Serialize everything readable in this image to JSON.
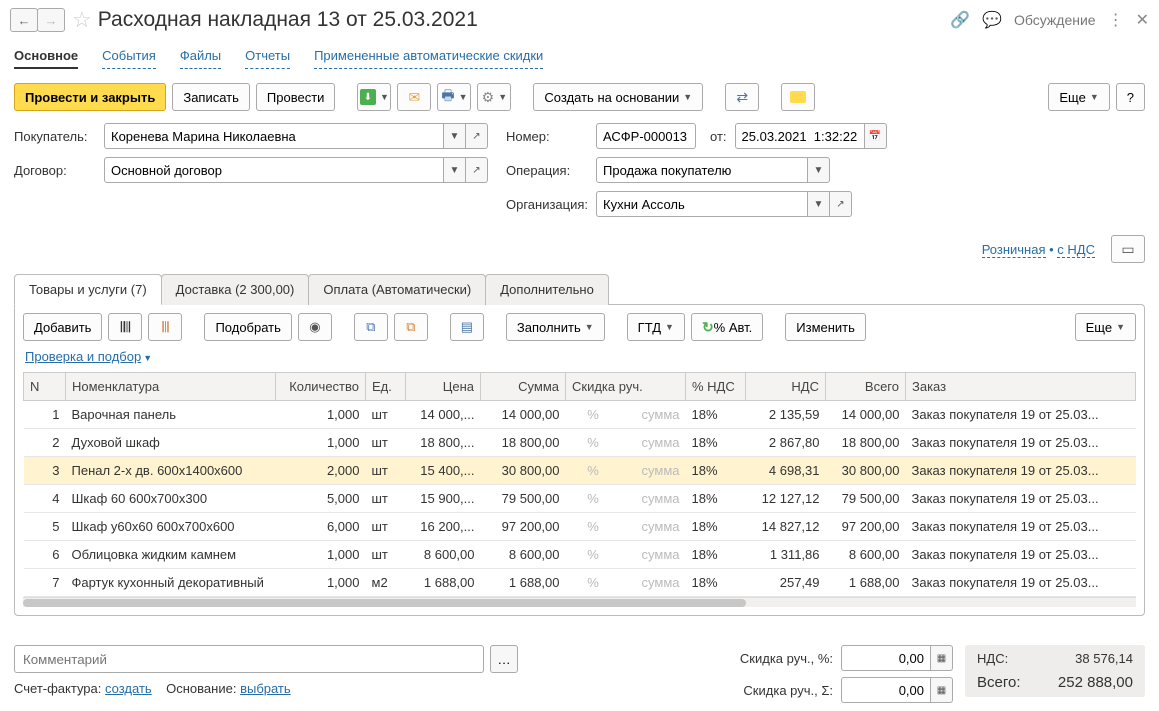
{
  "header": {
    "title": "Расходная накладная 13  от 25.03.2021",
    "discuss": "Обсуждение"
  },
  "nav": {
    "main": "Основное",
    "events": "События",
    "files": "Файлы",
    "reports": "Отчеты",
    "auto_discounts": "Примененные автоматические скидки"
  },
  "toolbar": {
    "post_close": "Провести и закрыть",
    "save": "Записать",
    "post": "Провести",
    "create_based": "Создать на основании",
    "more": "Еще",
    "help": "?"
  },
  "form": {
    "buyer_label": "Покупатель:",
    "buyer": "Коренева Марина Николаевна",
    "number_label": "Номер:",
    "number": "АСФР-000013",
    "date_label": "от:",
    "date": "25.03.2021  1:32:22",
    "contract_label": "Договор:",
    "contract": "Основной договор",
    "operation_label": "Операция:",
    "operation": "Продажа покупателю",
    "org_label": "Организация:",
    "org": "Кухни Ассоль",
    "retail": "Розничная",
    "vat": "с НДС"
  },
  "tabs": {
    "goods": "Товары и услуги (7)",
    "delivery": "Доставка (2 300,00)",
    "payment": "Оплата (Автоматически)",
    "extra": "Дополнительно"
  },
  "table_toolbar": {
    "add": "Добавить",
    "select": "Подобрать",
    "fill": "Заполнить",
    "gtd": "ГТД",
    "auto_pct": "% Авт.",
    "change": "Изменить",
    "more": "Еще",
    "check_select": "Проверка и подбор"
  },
  "columns": {
    "n": "N",
    "item": "Номенклатура",
    "qty": "Количество",
    "unit": "Ед.",
    "price": "Цена",
    "sum": "Сумма",
    "man_disc": "Скидка руч.",
    "vat_pct": "% НДС",
    "vat": "НДС",
    "total": "Всего",
    "order": "Заказ"
  },
  "placeholders": {
    "pct": "%",
    "sum": "сумма"
  },
  "rows": [
    {
      "n": "1",
      "item": "Варочная панель",
      "qty": "1,000",
      "unit": "шт",
      "price": "14 000,...",
      "sum": "14 000,00",
      "vat_pct": "18%",
      "vat": "2 135,59",
      "total": "14 000,00",
      "order": "Заказ покупателя 19 от 25.03..."
    },
    {
      "n": "2",
      "item": "Духовой шкаф",
      "qty": "1,000",
      "unit": "шт",
      "price": "18 800,...",
      "sum": "18 800,00",
      "vat_pct": "18%",
      "vat": "2 867,80",
      "total": "18 800,00",
      "order": "Заказ покупателя 19 от 25.03..."
    },
    {
      "n": "3",
      "item": "Пенал 2-х дв. 600х1400х600",
      "qty": "2,000",
      "unit": "шт",
      "price": "15 400,...",
      "sum": "30 800,00",
      "vat_pct": "18%",
      "vat": "4 698,31",
      "total": "30 800,00",
      "order": "Заказ покупателя 19 от 25.03...",
      "selected": true
    },
    {
      "n": "4",
      "item": "Шкаф 60 600х700х300",
      "qty": "5,000",
      "unit": "шт",
      "price": "15 900,...",
      "sum": "79 500,00",
      "vat_pct": "18%",
      "vat": "12 127,12",
      "total": "79 500,00",
      "order": "Заказ покупателя 19 от 25.03..."
    },
    {
      "n": "5",
      "item": "Шкаф у60х60 600х700х600",
      "qty": "6,000",
      "unit": "шт",
      "price": "16 200,...",
      "sum": "97 200,00",
      "vat_pct": "18%",
      "vat": "14 827,12",
      "total": "97 200,00",
      "order": "Заказ покупателя 19 от 25.03..."
    },
    {
      "n": "6",
      "item": "Облицовка жидким камнем",
      "qty": "1,000",
      "unit": "шт",
      "price": "8 600,00",
      "sum": "8 600,00",
      "vat_pct": "18%",
      "vat": "1 311,86",
      "total": "8 600,00",
      "order": "Заказ покупателя 19 от 25.03..."
    },
    {
      "n": "7",
      "item": "Фартук кухонный декоративный",
      "qty": "1,000",
      "unit": "м2",
      "price": "1 688,00",
      "sum": "1 688,00",
      "vat_pct": "18%",
      "vat": "257,49",
      "total": "1 688,00",
      "order": "Заказ покупателя 19 от 25.03..."
    }
  ],
  "footer": {
    "comment_ph": "Комментарий",
    "disc_pct_label": "Скидка руч., %:",
    "disc_pct": "0,00",
    "disc_sum_label": "Скидка руч., Σ:",
    "disc_sum": "0,00",
    "vat_label": "НДС:",
    "vat_total": "38 576,14",
    "total_label": "Всего:",
    "total": "252 888,00",
    "invoice_label": "Счет-фактура:",
    "invoice_link": "создать",
    "basis_label": "Основание:",
    "basis_link": "выбрать"
  }
}
